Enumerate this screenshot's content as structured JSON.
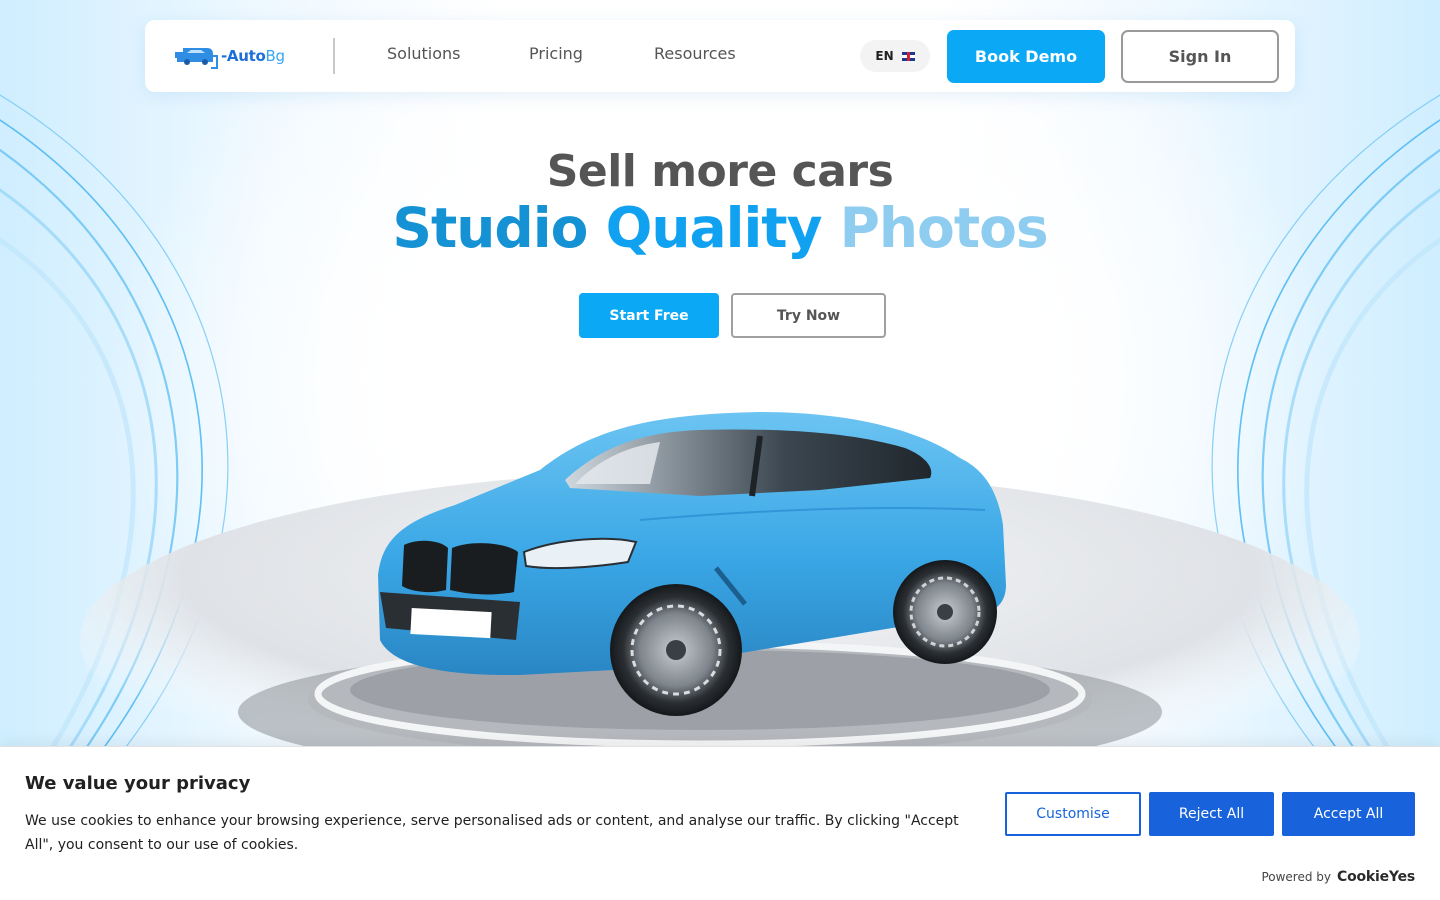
{
  "nav": {
    "logo_main": "-Auto",
    "logo_accent": "Bg",
    "links": [
      "Solutions",
      "Pricing",
      "Resources"
    ],
    "lang": "EN",
    "book_demo": "Book Demo",
    "sign_in": "Sign In"
  },
  "hero": {
    "line1": "Sell more cars",
    "line2_words": [
      "Studio",
      "Quality",
      "Photos"
    ],
    "start_free": "Start Free",
    "try_now": "Try Now"
  },
  "cookie": {
    "title": "We value your privacy",
    "text": "We use cookies to enhance your browsing experience, serve personalised ads or content, and analyse our traffic. By clicking \"Accept All\", you consent to our use of cookies.",
    "customise": "Customise",
    "reject": "Reject All",
    "accept": "Accept All",
    "powered_by": "Powered by",
    "brand": "CookieYes"
  },
  "colors": {
    "accent": "#0aa8f5",
    "cookie_blue": "#1863dc",
    "headline_dark": "#1592d4",
    "headline_mid": "#10a2f0",
    "headline_light": "#8fcdf0"
  },
  "icons": {
    "logo": "car-icon",
    "flag": "uk-flag-icon"
  }
}
